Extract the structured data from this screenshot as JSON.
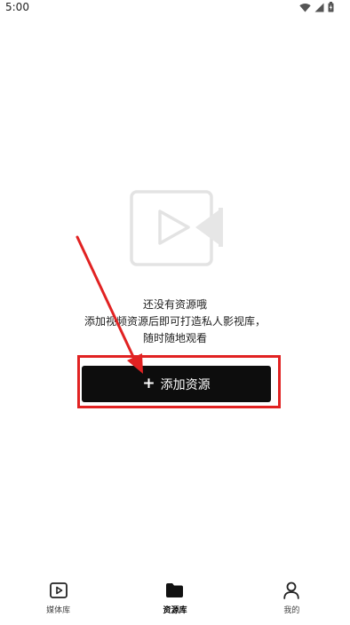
{
  "status_bar": {
    "time": "5:00",
    "icons": [
      "wifi-icon",
      "cell-signal-icon",
      "battery-icon"
    ]
  },
  "empty_state": {
    "illustration_icon": "video-play-placeholder-icon",
    "title": "还没有资源哦",
    "description_line1": "添加视频资源后即可打造私人影视库，",
    "description_line2": "随时随地观看"
  },
  "add_button": {
    "icon": "plus-icon",
    "label": "添加资源"
  },
  "annotation": {
    "color": "#e12222"
  },
  "bottom_nav": {
    "active_index": 1,
    "items": [
      {
        "label": "媒体库",
        "icon": "media-library-icon"
      },
      {
        "label": "资源库",
        "icon": "folder-icon"
      },
      {
        "label": "我的",
        "icon": "profile-icon"
      }
    ]
  }
}
